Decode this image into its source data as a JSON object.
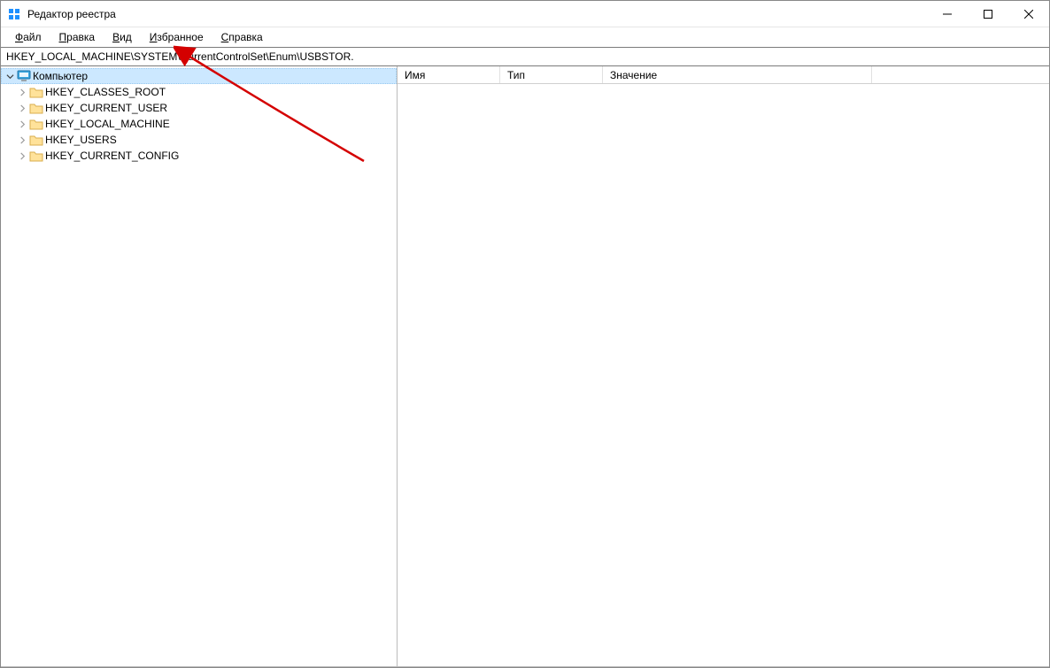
{
  "window": {
    "title": "Редактор реестра"
  },
  "menu": {
    "file": "Файл",
    "edit": "Правка",
    "view": "Вид",
    "favorites": "Избранное",
    "help": "Справка"
  },
  "address": {
    "value": "HKEY_LOCAL_MACHINE\\SYSTEM\\CurrentControlSet\\Enum\\USBSTOR."
  },
  "tree": {
    "root": "Компьютер",
    "hives": [
      "HKEY_CLASSES_ROOT",
      "HKEY_CURRENT_USER",
      "HKEY_LOCAL_MACHINE",
      "HKEY_USERS",
      "HKEY_CURRENT_CONFIG"
    ]
  },
  "list_columns": {
    "name": "Имя",
    "type": "Тип",
    "value": "Значение"
  }
}
